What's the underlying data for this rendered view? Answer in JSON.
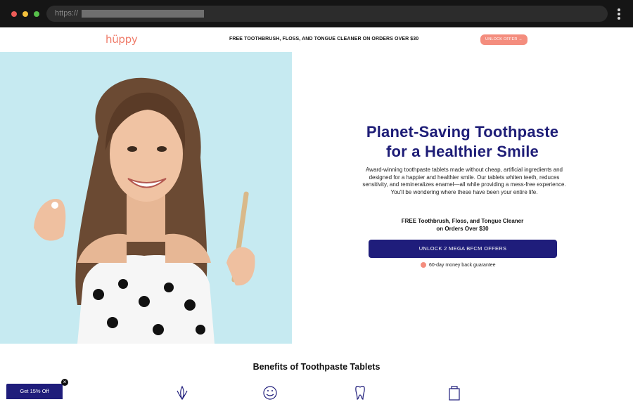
{
  "browser": {
    "url_prefix": "https://",
    "icons": [
      "close-dot",
      "minimize-dot",
      "maximize-dot",
      "kebab-menu-icon"
    ]
  },
  "topbar": {
    "logo": "hüppy",
    "promo": "FREE TOOTHBRUSH, FLOSS, AND TONGUE CLEANER ON ORDERS OVER $30",
    "unlock_label": "UNLOCK OFFER →"
  },
  "hero": {
    "headline_line1": "Planet-Saving Toothpaste",
    "headline_line2": "for a Healthier Smile",
    "description": "Award-winning toothpaste tablets made without cheap, artificial ingredients and designed for a happier and healthier smile. Our tablets whiten teeth, reduces sensitivity, and remineralizes enamel—all while providing a mess-free experience. You'll be wondering where these have been your entire life.",
    "offer_line1": "FREE Toothbrush, Floss, and Tongue Cleaner",
    "offer_line2": "on Orders Over $30",
    "cta_label": "UNLOCK 2 MEGA BFCM OFFERS",
    "guarantee": "60-day money back guarantee"
  },
  "benefits": {
    "title": "Benefits of Toothpaste Tablets",
    "icons": [
      "leaf-icon",
      "smile-icon",
      "tooth-icon",
      "package-icon"
    ]
  },
  "popup": {
    "label": "Get 15% Off",
    "close": "×"
  },
  "colors": {
    "brand_navy": "#1f1d7b",
    "brand_coral": "#f48d7e",
    "hero_bg": "#c6eaf1"
  }
}
